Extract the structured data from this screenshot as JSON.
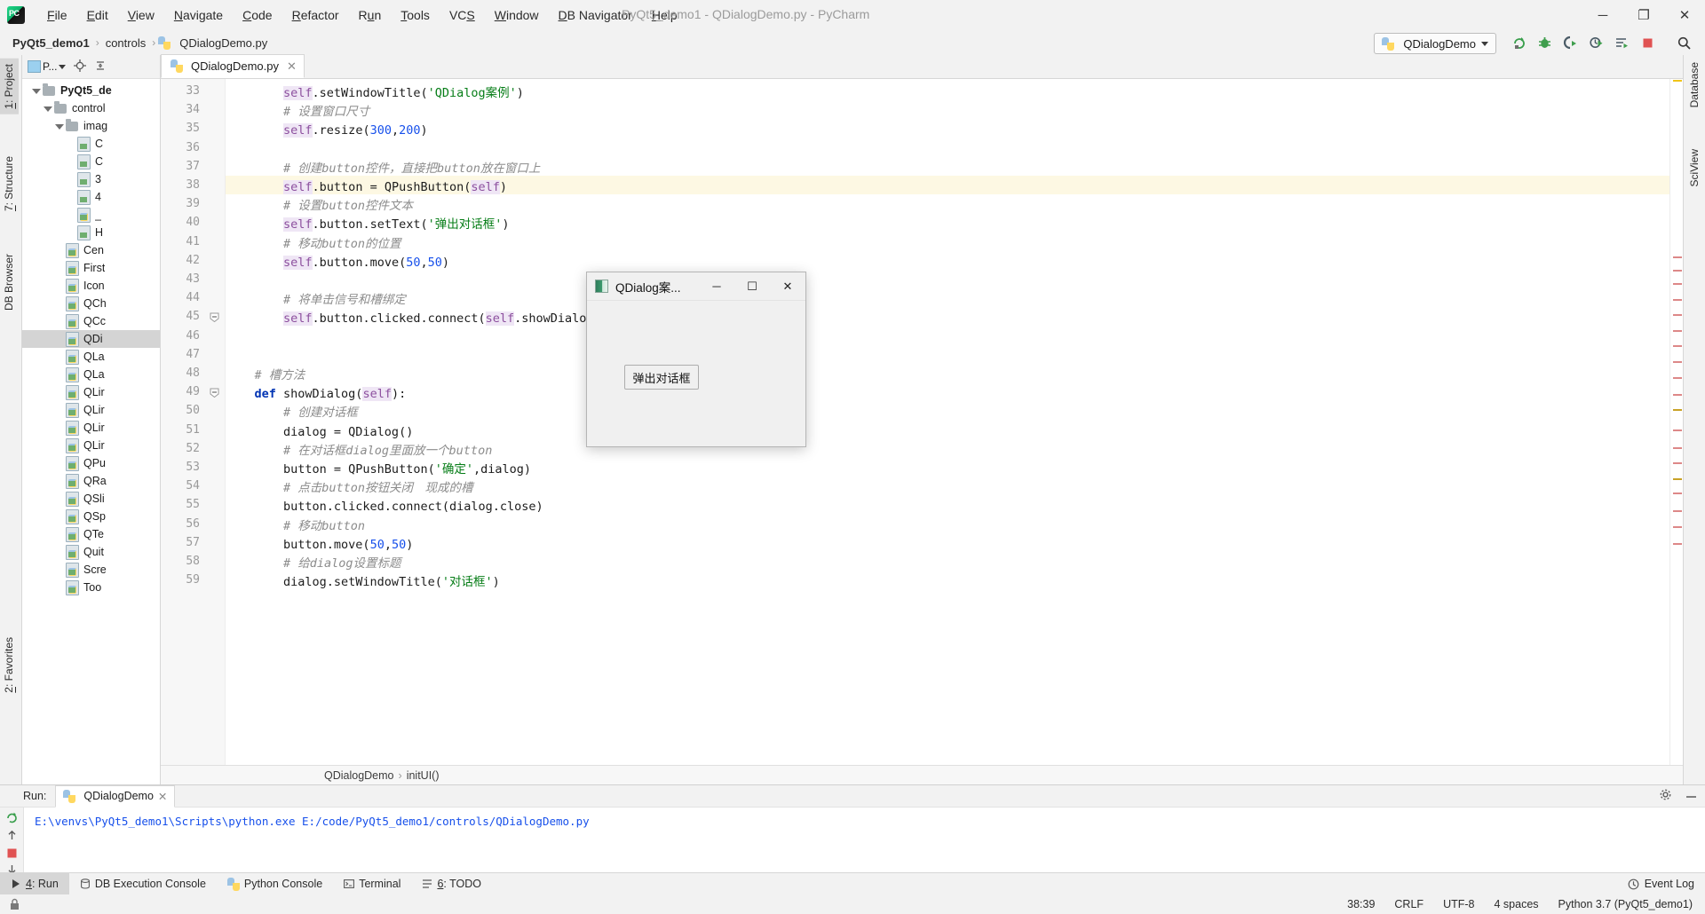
{
  "window": {
    "title": "PyQt5_demo1 - QDialogDemo.py - PyCharm",
    "minimize": "─",
    "maximize": "❐",
    "close": "✕"
  },
  "menu": {
    "items": [
      {
        "pre": "",
        "accel": "F",
        "post": "ile"
      },
      {
        "pre": "",
        "accel": "E",
        "post": "dit"
      },
      {
        "pre": "",
        "accel": "V",
        "post": "iew"
      },
      {
        "pre": "",
        "accel": "N",
        "post": "avigate"
      },
      {
        "pre": "",
        "accel": "C",
        "post": "ode"
      },
      {
        "pre": "",
        "accel": "R",
        "post": "efactor"
      },
      {
        "pre": "R",
        "accel": "u",
        "post": "n"
      },
      {
        "pre": "",
        "accel": "T",
        "post": "ools"
      },
      {
        "pre": "VC",
        "accel": "S",
        "post": ""
      },
      {
        "pre": "",
        "accel": "W",
        "post": "indow"
      },
      {
        "pre": "",
        "accel": "D",
        "post": "B Navigator"
      },
      {
        "pre": "",
        "accel": "H",
        "post": "elp"
      }
    ]
  },
  "breadcrumb": {
    "project": "PyQt5_demo1",
    "folder": "controls",
    "file": "QDialogDemo.py",
    "separator": "›"
  },
  "toolbar": {
    "run_config": "QDialogDemo",
    "icons": [
      "rerun-icon",
      "debug-icon",
      "coverage-icon",
      "profile-icon",
      "run-with-console-icon",
      "stop-icon",
      "search-icon"
    ]
  },
  "left_strip": {
    "tabs": [
      {
        "pre": "",
        "accel": "1",
        "post": ": Project"
      },
      {
        "pre": "",
        "accel": "7",
        "post": ": Structure"
      },
      {
        "pre": "DB Browser",
        "accel": "",
        "post": ""
      },
      {
        "pre": "",
        "accel": "2",
        "post": ": Favorites"
      }
    ]
  },
  "right_strip": {
    "tabs": [
      "Database",
      "SciView"
    ]
  },
  "project_panel": {
    "selector_label": "P...",
    "icons": [
      "locate-icon",
      "collapse-all-icon",
      "settings-icon",
      "hide-icon"
    ],
    "tree": [
      {
        "indent": 0,
        "arrow": "open",
        "icon": "folder",
        "label": "PyQt5_de",
        "bold": true
      },
      {
        "indent": 1,
        "arrow": "open",
        "icon": "folder",
        "label": "control",
        "bold": false
      },
      {
        "indent": 2,
        "arrow": "open",
        "icon": "folder",
        "label": "imag",
        "bold": false
      },
      {
        "indent": 3,
        "arrow": "none",
        "icon": "image",
        "label": "C",
        "bold": false
      },
      {
        "indent": 3,
        "arrow": "none",
        "icon": "image",
        "label": "C",
        "bold": false
      },
      {
        "indent": 3,
        "arrow": "none",
        "icon": "image",
        "label": "3",
        "bold": false
      },
      {
        "indent": 3,
        "arrow": "none",
        "icon": "image",
        "label": "4",
        "bold": false
      },
      {
        "indent": 3,
        "arrow": "none",
        "icon": "python",
        "label": "_",
        "bold": false
      },
      {
        "indent": 3,
        "arrow": "none",
        "icon": "image",
        "label": "H",
        "bold": false
      },
      {
        "indent": 2,
        "arrow": "none",
        "icon": "python",
        "label": "Cen",
        "bold": false
      },
      {
        "indent": 2,
        "arrow": "none",
        "icon": "python",
        "label": "First",
        "bold": false
      },
      {
        "indent": 2,
        "arrow": "none",
        "icon": "python",
        "label": "Icon",
        "bold": false
      },
      {
        "indent": 2,
        "arrow": "none",
        "icon": "python",
        "label": "QCh",
        "bold": false
      },
      {
        "indent": 2,
        "arrow": "none",
        "icon": "python",
        "label": "QCc",
        "bold": false
      },
      {
        "indent": 2,
        "arrow": "none",
        "icon": "python",
        "label": "QDi",
        "bold": false,
        "selected": true
      },
      {
        "indent": 2,
        "arrow": "none",
        "icon": "python",
        "label": "QLa",
        "bold": false
      },
      {
        "indent": 2,
        "arrow": "none",
        "icon": "python",
        "label": "QLa",
        "bold": false
      },
      {
        "indent": 2,
        "arrow": "none",
        "icon": "python",
        "label": "QLir",
        "bold": false
      },
      {
        "indent": 2,
        "arrow": "none",
        "icon": "python",
        "label": "QLir",
        "bold": false
      },
      {
        "indent": 2,
        "arrow": "none",
        "icon": "python",
        "label": "QLir",
        "bold": false
      },
      {
        "indent": 2,
        "arrow": "none",
        "icon": "python",
        "label": "QLir",
        "bold": false
      },
      {
        "indent": 2,
        "arrow": "none",
        "icon": "python",
        "label": "QPu",
        "bold": false
      },
      {
        "indent": 2,
        "arrow": "none",
        "icon": "python",
        "label": "QRa",
        "bold": false
      },
      {
        "indent": 2,
        "arrow": "none",
        "icon": "python",
        "label": "QSli",
        "bold": false
      },
      {
        "indent": 2,
        "arrow": "none",
        "icon": "python",
        "label": "QSp",
        "bold": false
      },
      {
        "indent": 2,
        "arrow": "none",
        "icon": "python",
        "label": "QTe",
        "bold": false
      },
      {
        "indent": 2,
        "arrow": "none",
        "icon": "python",
        "label": "Quit",
        "bold": false
      },
      {
        "indent": 2,
        "arrow": "none",
        "icon": "python",
        "label": "Scre",
        "bold": false
      },
      {
        "indent": 2,
        "arrow": "none",
        "icon": "python",
        "label": "Too",
        "bold": false
      }
    ]
  },
  "editor": {
    "tab_label": "QDialogDemo.py",
    "tab_close": "✕",
    "first_line_number": 33,
    "highlight_line": 38,
    "lines": [
      {
        "n": 33,
        "text": "        self.setWindowTitle('QDialog案例')"
      },
      {
        "n": 34,
        "text": "        # 设置窗口尺寸"
      },
      {
        "n": 35,
        "text": "        self.resize(300,200)"
      },
      {
        "n": 36,
        "text": ""
      },
      {
        "n": 37,
        "text": "        # 创建button控件，直接把button放在窗口上"
      },
      {
        "n": 38,
        "text": "        self.button = QPushButton(self)"
      },
      {
        "n": 39,
        "text": "        # 设置button控件文本"
      },
      {
        "n": 40,
        "text": "        self.button.setText('弹出对话框')"
      },
      {
        "n": 41,
        "text": "        # 移动button的位置"
      },
      {
        "n": 42,
        "text": "        self.button.move(50,50)"
      },
      {
        "n": 43,
        "text": ""
      },
      {
        "n": 44,
        "text": "        # 将单击信号和槽绑定"
      },
      {
        "n": 45,
        "text": "        self.button.clicked.connect(self.showDialog)"
      },
      {
        "n": 46,
        "text": ""
      },
      {
        "n": 47,
        "text": ""
      },
      {
        "n": 48,
        "text": "    # 槽方法"
      },
      {
        "n": 49,
        "text": "    def showDialog(self):"
      },
      {
        "n": 50,
        "text": "        # 创建对话框"
      },
      {
        "n": 51,
        "text": "        dialog = QDialog()"
      },
      {
        "n": 52,
        "text": "        # 在对话框dialog里面放一个button"
      },
      {
        "n": 53,
        "text": "        button = QPushButton('确定',dialog)"
      },
      {
        "n": 54,
        "text": "        # 点击button按钮关闭　现成的槽"
      },
      {
        "n": 55,
        "text": "        button.clicked.connect(dialog.close)"
      },
      {
        "n": 56,
        "text": "        # 移动button"
      },
      {
        "n": 57,
        "text": "        button.move(50,50)"
      },
      {
        "n": 58,
        "text": "        # 给dialog设置标题"
      },
      {
        "n": 59,
        "text": "        dialog.setWindowTitle('对话框')"
      }
    ],
    "underbreadcrumb": [
      "QDialogDemo",
      "initUI()"
    ],
    "underbreadcrumb_separator": "›"
  },
  "qt_dialog": {
    "title": "QDialog案...",
    "minimize": "─",
    "maximize": "☐",
    "close": "✕",
    "button_label": "弹出对话框"
  },
  "run_panel": {
    "label": "Run:",
    "tab_label": "QDialogDemo",
    "tab_close": "✕",
    "console_text": "E:\\venvs\\PyQt5_demo1\\Scripts\\python.exe E:/code/PyQt5_demo1/controls/QDialogDemo.py",
    "settings_icon": "gear-icon",
    "minimize_icon": "minimize-icon"
  },
  "bottom_bar": {
    "tabs": [
      {
        "pre": "",
        "accel": "4",
        "post": ": Run",
        "active": true,
        "icon": "run-icon"
      },
      {
        "pre": "DB Execution Console",
        "accel": "",
        "post": "",
        "active": false,
        "icon": "db-console-icon"
      },
      {
        "pre": "Python Console",
        "accel": "",
        "post": "",
        "active": false,
        "icon": "python-console-icon"
      },
      {
        "pre": "Terminal",
        "accel": "",
        "post": "",
        "active": false,
        "icon": "terminal-icon"
      },
      {
        "pre": "",
        "accel": "6",
        "post": ": TODO",
        "active": false,
        "icon": "todo-icon"
      }
    ],
    "event_log": "Event Log"
  },
  "status_bar": {
    "position": "38:39",
    "line_separator": "CRLF",
    "encoding": "UTF-8",
    "indent": "4 spaces",
    "interpreter": "Python 3.7 (PyQt5_demo1)",
    "lock_icon": "lock-icon"
  },
  "colors": {
    "accent_blue": "#1750eb",
    "keyword": "#0033b3",
    "string": "#067d17",
    "comment": "#8c8c8c",
    "self_purple": "#8c4f9e",
    "highlight_row": "#fdf8e3",
    "selection_teal": "#93e0e3"
  }
}
